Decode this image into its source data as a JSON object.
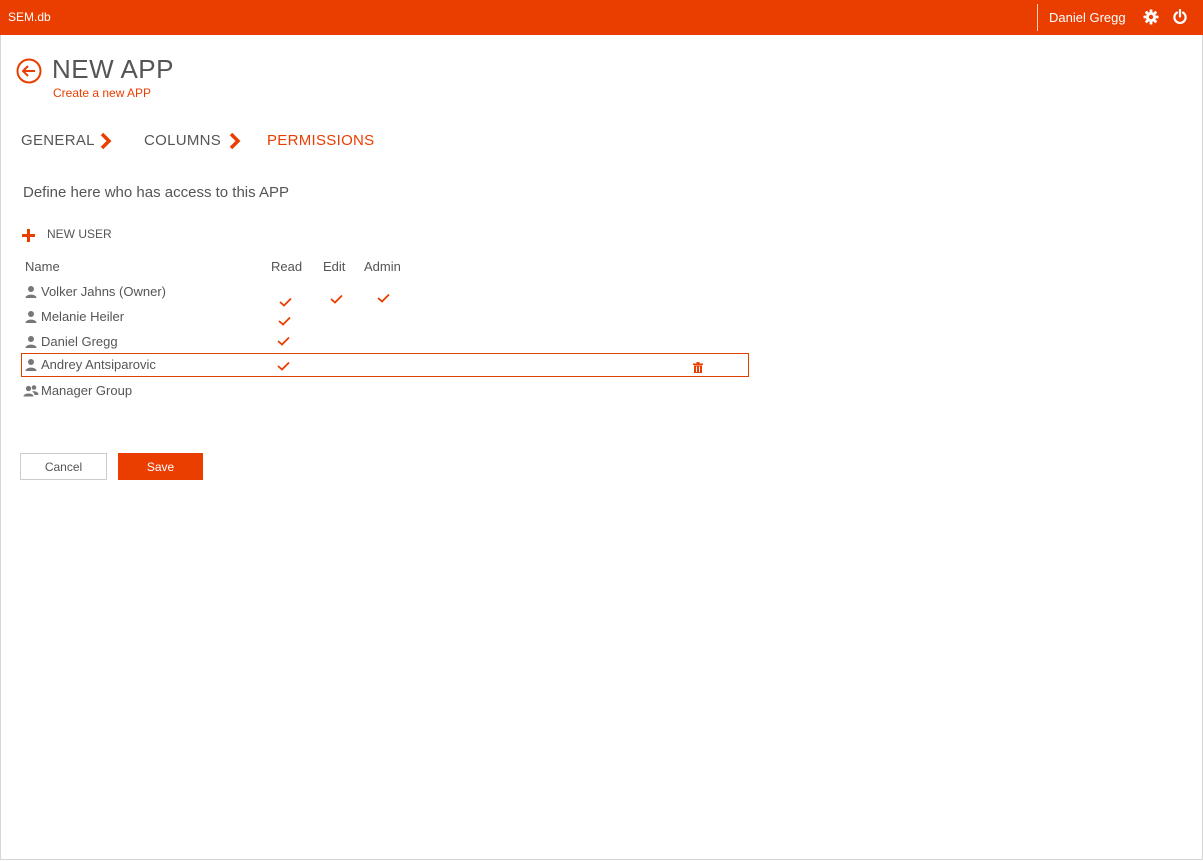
{
  "app": {
    "name": "SEM.db",
    "current_user": "Daniel Gregg",
    "accent_color": "#ea3e00"
  },
  "header": {
    "title": "NEW APP",
    "subtitle": "Create a new APP"
  },
  "steps": [
    {
      "label": "GENERAL",
      "active": false
    },
    {
      "label": "COLUMNS",
      "active": false
    },
    {
      "label": "PERMISSIONS",
      "active": true
    }
  ],
  "intro": "Define here who has access to this APP",
  "new_user_label": "NEW USER",
  "table": {
    "headers": {
      "name": "Name",
      "read": "Read",
      "edit": "Edit",
      "admin": "Admin"
    },
    "rows": [
      {
        "name": "Volker Jahns (Owner)",
        "icon": "user-icon",
        "read": true,
        "edit": true,
        "admin": true,
        "selected": false
      },
      {
        "name": "Melanie Heiler",
        "icon": "user-icon",
        "read": true,
        "edit": false,
        "admin": false,
        "selected": false
      },
      {
        "name": "Daniel Gregg",
        "icon": "user-icon",
        "read": true,
        "edit": false,
        "admin": false,
        "selected": false
      },
      {
        "name": "Andrey Antsiparovic",
        "icon": "user-icon",
        "read": true,
        "edit": false,
        "admin": false,
        "selected": true
      },
      {
        "name": "Manager Group",
        "icon": "group-icon",
        "read": false,
        "edit": false,
        "admin": false,
        "selected": false
      }
    ]
  },
  "buttons": {
    "cancel": "Cancel",
    "save": "Save"
  },
  "icons": {
    "settings": "gear-icon",
    "logout": "power-icon",
    "back": "back-arrow-icon",
    "add": "plus-icon",
    "delete": "trash-icon"
  }
}
